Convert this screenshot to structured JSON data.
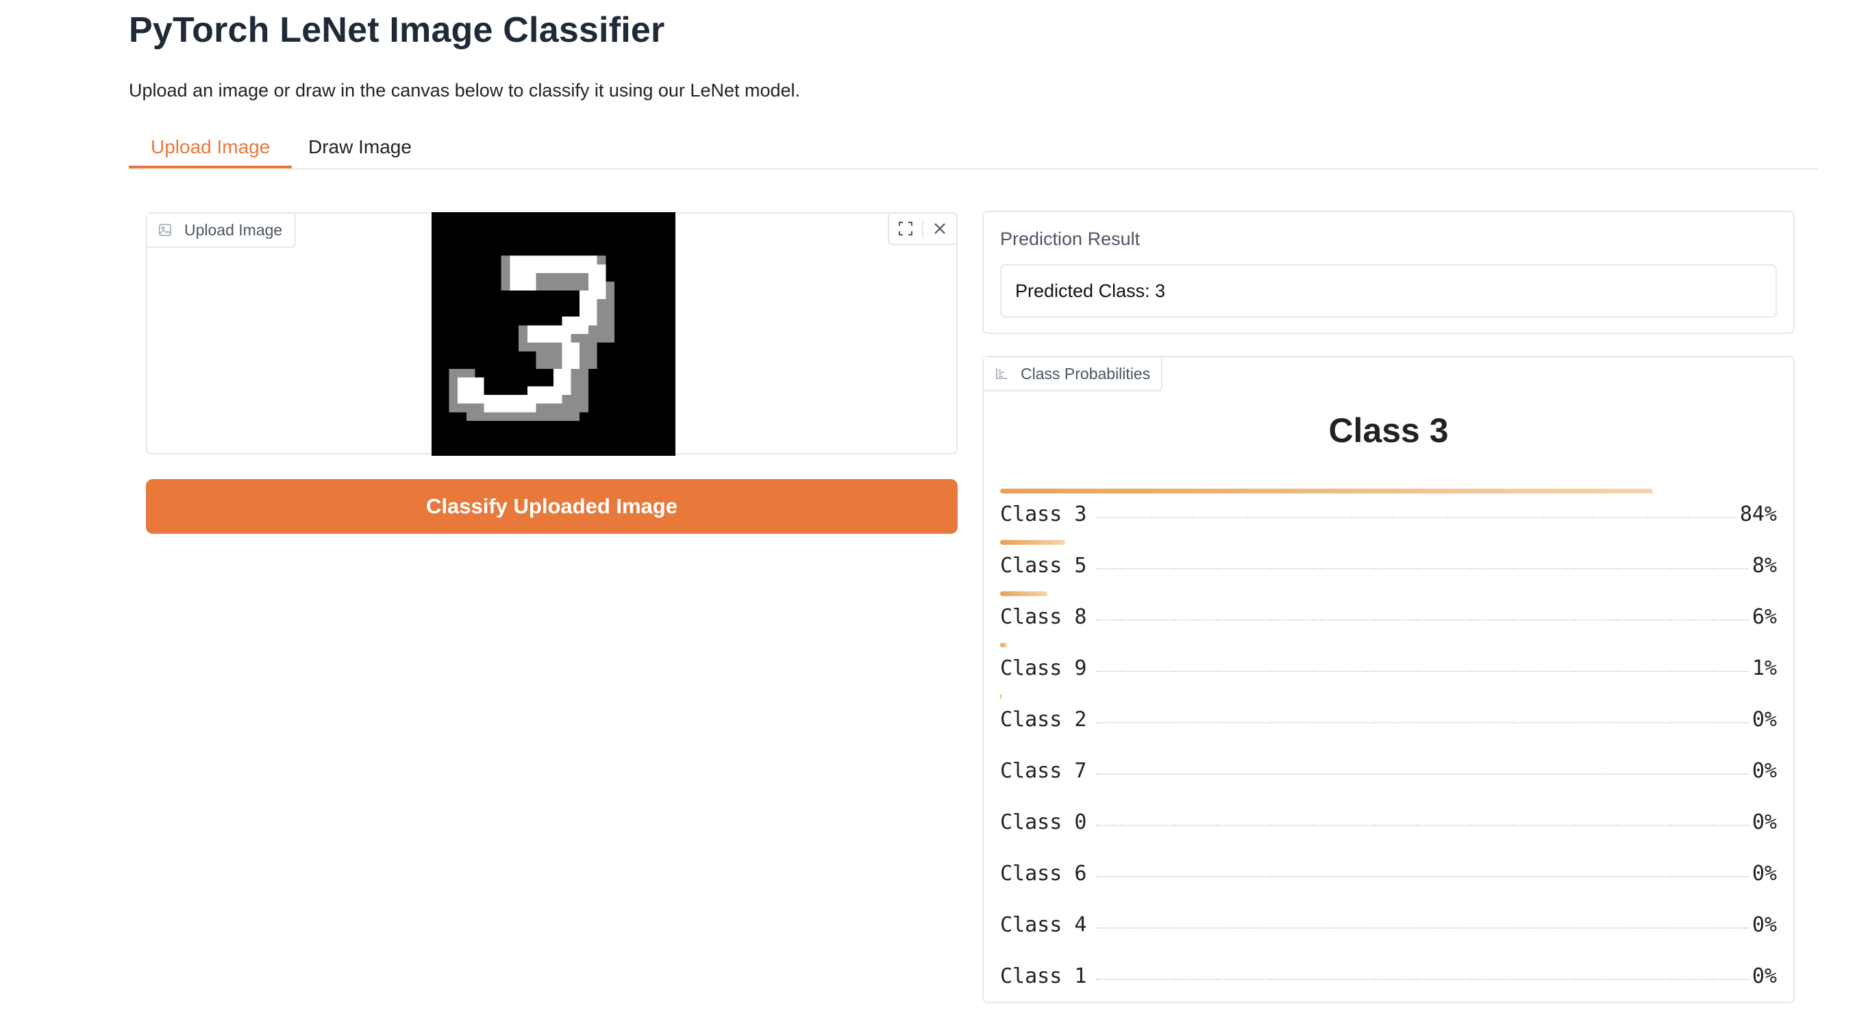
{
  "header": {
    "title": "PyTorch LeNet Image Classifier",
    "subtitle": "Upload an image or draw in the canvas below to classify it using our LeNet model."
  },
  "tabs": [
    {
      "label": "Upload Image",
      "active": true
    },
    {
      "label": "Draw Image",
      "active": false
    }
  ],
  "upload": {
    "label": "Upload Image",
    "button_label": "Classify Uploaded Image"
  },
  "result": {
    "label": "Prediction Result",
    "value": "Predicted Class: 3"
  },
  "probabilities": {
    "label": "Class Probabilities",
    "heading": "Class 3",
    "items": [
      {
        "label": "Class 3",
        "value": "84%",
        "fraction": 0.84
      },
      {
        "label": "Class 5",
        "value": "8%",
        "fraction": 0.084
      },
      {
        "label": "Class 8",
        "value": "6%",
        "fraction": 0.061
      },
      {
        "label": "Class 9",
        "value": "1%",
        "fraction": 0.009
      },
      {
        "label": "Class 2",
        "value": "0%",
        "fraction": 0.002
      },
      {
        "label": "Class 7",
        "value": "0%",
        "fraction": 0.0
      },
      {
        "label": "Class 0",
        "value": "0%",
        "fraction": 0.0
      },
      {
        "label": "Class 6",
        "value": "0%",
        "fraction": 0.0
      },
      {
        "label": "Class 4",
        "value": "0%",
        "fraction": 0.0
      },
      {
        "label": "Class 1",
        "value": "0%",
        "fraction": 0.0
      }
    ]
  },
  "colors": {
    "accent": "#e8793a",
    "bar_start": "#e8a055",
    "bar_end": "#f6d5ae",
    "border": "#e5e7eb"
  },
  "icons": {
    "upload_label_icon": "image-icon",
    "prob_label_icon": "bar-chart-icon",
    "fullscreen": "fullscreen-icon",
    "close": "close-icon"
  }
}
